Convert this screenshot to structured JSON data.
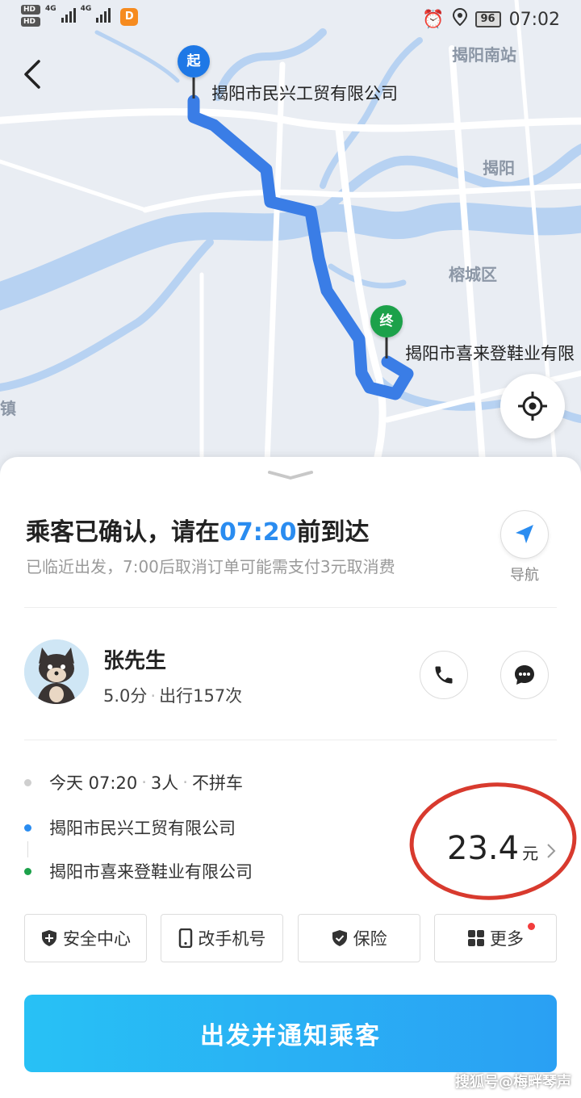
{
  "status_bar": {
    "hd1": "HD",
    "hd2": "HD",
    "net1": "4G",
    "net2": "4G",
    "app_icon": "D",
    "battery": "96",
    "time": "07:02"
  },
  "map": {
    "start_pin": "起",
    "end_pin": "终",
    "start_place": "揭阳市民兴工贸有限公司",
    "end_place": "揭阳市喜来登鞋业有限",
    "labels": {
      "south_station": "揭阳南站",
      "jieyang": "揭阳",
      "rongcheng": "榕城区",
      "zhen": "镇"
    }
  },
  "status": {
    "title_prefix": "乘客已确认，请在",
    "title_time": "07:20",
    "title_suffix": "前到达",
    "subtitle": "已临近出发，7:00后取消订单可能需支付3元取消费",
    "nav_label": "导航"
  },
  "passenger": {
    "name": "张先生",
    "rating": "5.0分",
    "trips": "出行157次"
  },
  "trip": {
    "day_time": "今天 07:20",
    "people": "3人",
    "carpool": "不拼车",
    "from": "揭阳市民兴工贸有限公司",
    "to": "揭阳市喜来登鞋业有限公司",
    "price": "23.4",
    "price_unit": "元"
  },
  "chips": {
    "safety": "安全中心",
    "phone": "改手机号",
    "insurance": "保险",
    "more": "更多"
  },
  "cta": "出发并通知乘客",
  "watermark": "搜狐号@梅畔琴声",
  "colors": {
    "accent_blue": "#2a8cf0",
    "start_blue": "#1e78e6",
    "end_green": "#1ca14a",
    "route": "#3a7de6",
    "river": "#b7d2f2",
    "highlight_circle": "#d83a2e"
  },
  "icons": [
    "back-icon",
    "locate-icon",
    "navigation-arrow-icon",
    "phone-icon",
    "message-icon",
    "shield-icon",
    "mobile-icon",
    "insurance-icon",
    "grid-icon",
    "chevron-right-icon"
  ]
}
